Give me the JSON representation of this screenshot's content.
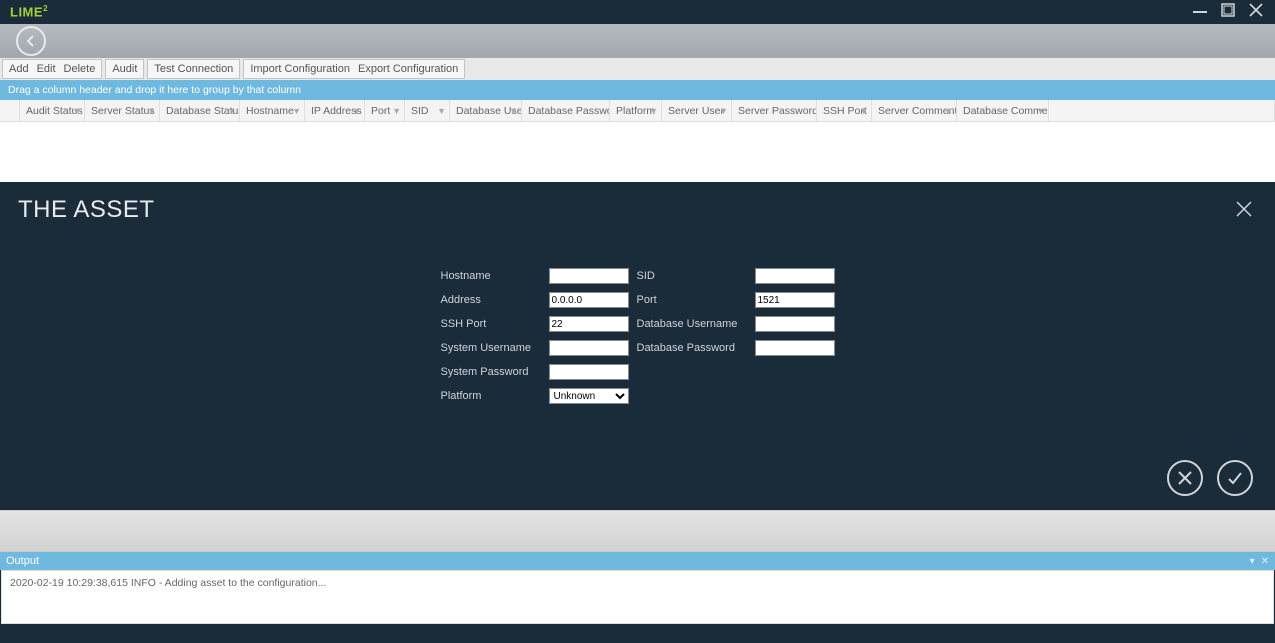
{
  "app": {
    "logo": "LIME",
    "logo_sup": "2"
  },
  "toolbar": {
    "add": "Add",
    "edit": "Edit",
    "delete": "Delete",
    "audit": "Audit",
    "test": "Test Connection",
    "importcfg": "Import Configuration",
    "exportcfg": "Export Configuration"
  },
  "groupbar": "Drag a column header and drop it here to group by that column",
  "columns": {
    "c0": "",
    "c1": "Audit Status",
    "c2": "Server Status",
    "c3": "Database Status",
    "c4": "Hostname",
    "c5": "IP Address",
    "c6": "Port",
    "c7": "SID",
    "c8": "Database User",
    "c9": "Database Password",
    "c10": "Platform",
    "c11": "Server User",
    "c12": "Server Password",
    "c13": "SSH Port",
    "c14": "Server Comment",
    "c15": "Database Comment"
  },
  "form": {
    "title": "THE ASSET",
    "labels": {
      "hostname": "Hostname",
      "sid": "SID",
      "address": "Address",
      "port": "Port",
      "sshport": "SSH Port",
      "dbuser": "Database Username",
      "sysuser": "System Username",
      "dbpass": "Database Password",
      "syspass": "System Password",
      "platform": "Platform"
    },
    "values": {
      "hostname": "",
      "sid": "",
      "address": "0.0.0.0",
      "port": "1521",
      "sshport": "22",
      "dbuser": "",
      "sysuser": "",
      "dbpass": "",
      "syspass": "",
      "platform": "Unknown"
    }
  },
  "output": {
    "title": "Output",
    "log": "2020-02-19 10:29:38,615 INFO - Adding asset to the configuration..."
  }
}
